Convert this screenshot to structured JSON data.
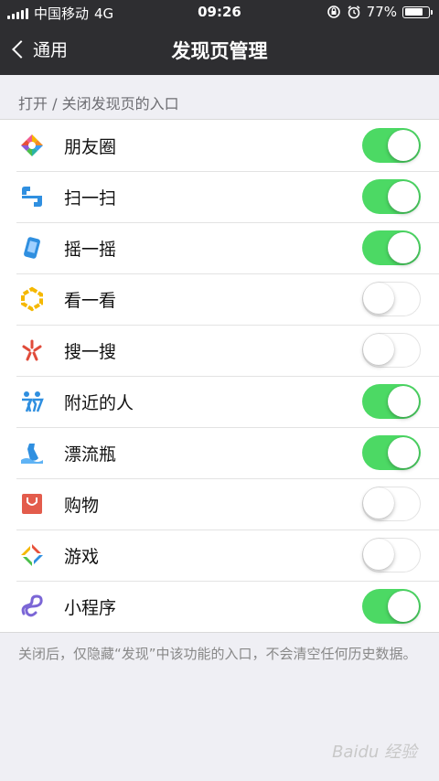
{
  "status_bar": {
    "carrier": "中国移动",
    "network": "4G",
    "time": "09:26",
    "battery": "77%",
    "battery_level": 0.77
  },
  "navbar": {
    "back_label": "通用",
    "title": "发现页管理"
  },
  "section_header": "打开 / 关闭发现页的入口",
  "items": [
    {
      "label": "朋友圈",
      "icon": "moments-icon",
      "enabled": true
    },
    {
      "label": "扫一扫",
      "icon": "scan-icon",
      "enabled": true
    },
    {
      "label": "摇一摇",
      "icon": "shake-icon",
      "enabled": true
    },
    {
      "label": "看一看",
      "icon": "top-stories-icon",
      "enabled": false
    },
    {
      "label": "搜一搜",
      "icon": "search-icon",
      "enabled": false
    },
    {
      "label": "附近的人",
      "icon": "people-nearby-icon",
      "enabled": true
    },
    {
      "label": "漂流瓶",
      "icon": "drift-bottle-icon",
      "enabled": true
    },
    {
      "label": "购物",
      "icon": "shopping-bag-icon",
      "enabled": false
    },
    {
      "label": "游戏",
      "icon": "games-icon",
      "enabled": false
    },
    {
      "label": "小程序",
      "icon": "mini-programs-icon",
      "enabled": true
    }
  ],
  "footer_note": "关闭后，仅隐藏“发现”中该功能的入口，不会清空任何历史数据。",
  "watermark": "Baidu 经验",
  "colors": {
    "switch_on": "#4cd964",
    "bar_background": "#2e2e31",
    "page_background": "#efeff4"
  }
}
